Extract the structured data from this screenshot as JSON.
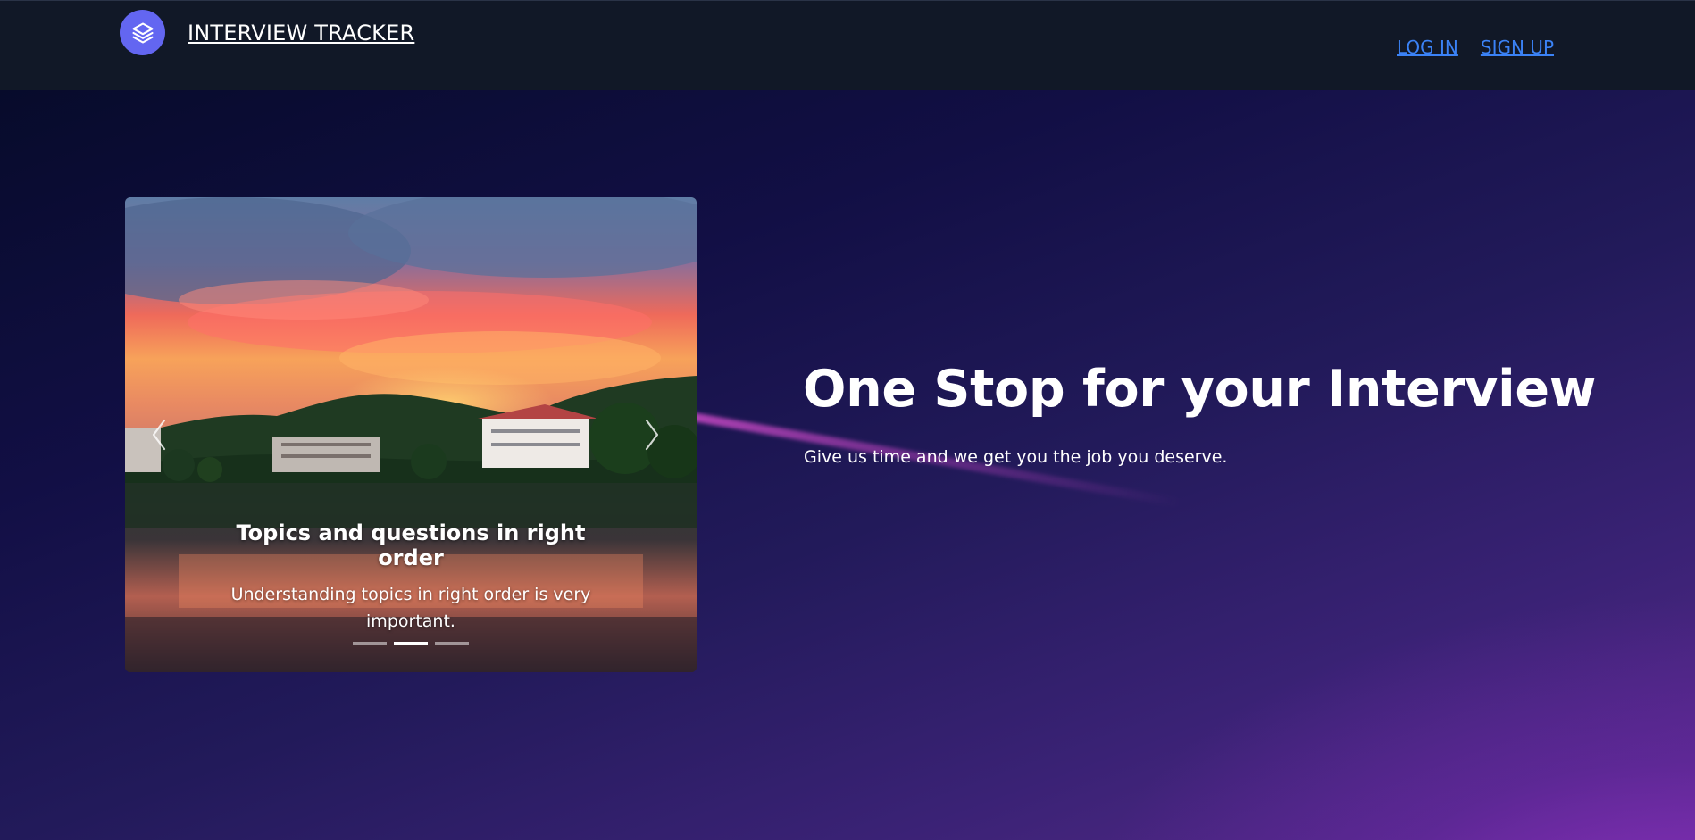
{
  "header": {
    "brand_name": "INTERVIEW TRACKER",
    "logo_icon": "layers-icon",
    "logo_color": "#6366f1",
    "nav": {
      "login_label": "LOG IN",
      "signup_label": "SIGN UP"
    }
  },
  "carousel": {
    "active_slide_index": 1,
    "slide_count": 3,
    "caption_title": "Topics and questions in right order",
    "caption_text": "Understanding topics in right order is very important.",
    "prev_icon": "chevron-left-icon",
    "next_icon": "chevron-right-icon"
  },
  "hero": {
    "headline": "One Stop for your Interview",
    "subline": "Give us time and we get you the job you deserve."
  },
  "colors": {
    "navbar_bg": "#111827",
    "link": "#3b82f6",
    "accent": "#6366f1"
  }
}
